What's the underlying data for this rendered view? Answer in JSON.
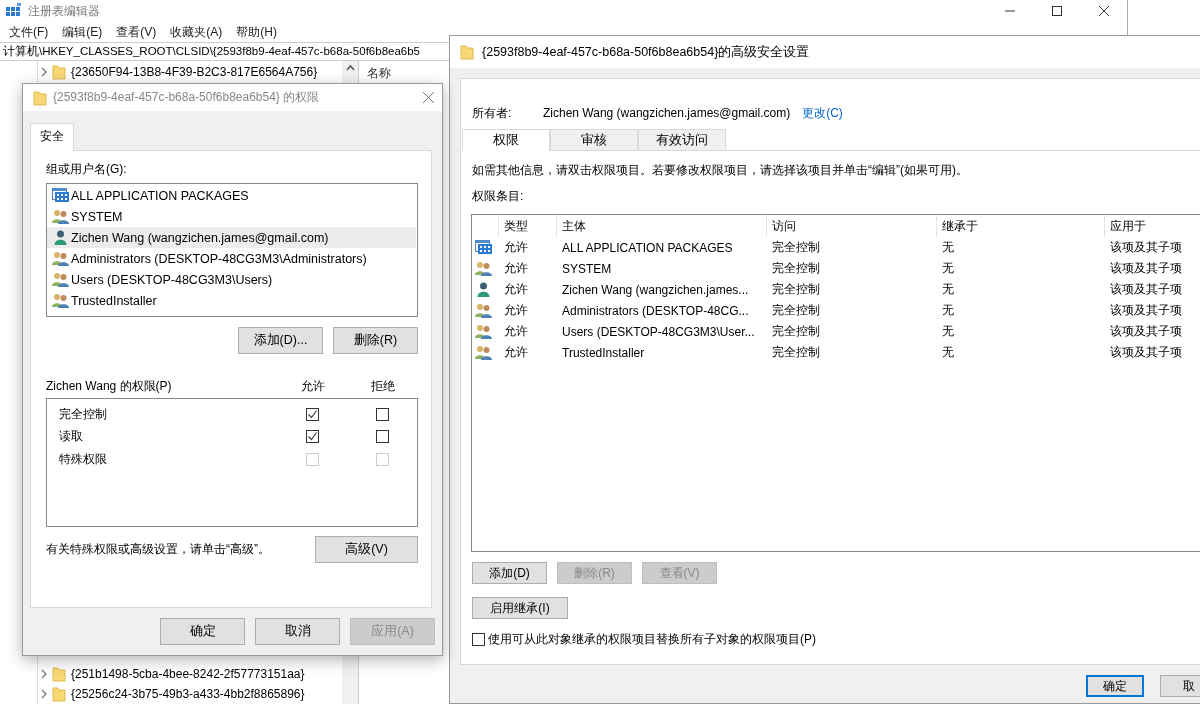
{
  "registry_editor": {
    "title": "注册表编辑器",
    "menu": [
      "文件(F)",
      "编辑(E)",
      "查看(V)",
      "收藏夹(A)",
      "帮助(H)"
    ],
    "address": "计算机\\HKEY_CLASSES_ROOT\\CLSID\\{2593f8b9-4eaf-457c-b68a-50f6b8ea6b5",
    "tree_top": [
      "{23650F94-13B8-4F39-B2C3-817E6564A756}"
    ],
    "tree_bottom": [
      "{251b1498-5cba-4bee-8242-2f57773151aa}",
      "{25256c24-3b75-49b3-a433-4bb2f8865896}"
    ],
    "list_header": "名称"
  },
  "permissions_dialog": {
    "title": "{2593f8b9-4eaf-457c-b68a-50f6b8ea6b54} 的权限",
    "tabs": [
      {
        "label": "安全",
        "selected": true
      }
    ],
    "group_label": "组或用户名(G):",
    "principals": [
      {
        "name": "ALL APPLICATION PACKAGES",
        "kind": "package",
        "selected": false
      },
      {
        "name": "SYSTEM",
        "kind": "group",
        "selected": false
      },
      {
        "name": "Zichen Wang (wangzichen.james@gmail.com)",
        "kind": "user",
        "selected": true
      },
      {
        "name": "Administrators (DESKTOP-48CG3M3\\Administrators)",
        "kind": "group",
        "selected": false
      },
      {
        "name": "Users (DESKTOP-48CG3M3\\Users)",
        "kind": "group",
        "selected": false
      },
      {
        "name": "TrustedInstaller",
        "kind": "group",
        "selected": false
      }
    ],
    "list_buttons": [
      "添加(D)...",
      "删除(R)"
    ],
    "perm_label": "Zichen Wang 的权限(P)",
    "allow_label": "允许",
    "deny_label": "拒绝",
    "permissions": [
      {
        "name": "完全控制",
        "allow": true,
        "deny": false,
        "disabled": false
      },
      {
        "name": "读取",
        "allow": true,
        "deny": false,
        "disabled": false
      },
      {
        "name": "特殊权限",
        "allow": false,
        "deny": false,
        "disabled": true
      }
    ],
    "advanced_hint": "有关特殊权限或高级设置，请单击“高级”。",
    "advanced_button": "高级(V)",
    "buttons": [
      {
        "label": "确定",
        "disabled": false
      },
      {
        "label": "取消",
        "disabled": false
      },
      {
        "label": "应用(A)",
        "disabled": true
      }
    ]
  },
  "advanced_dialog": {
    "title": "{2593f8b9-4eaf-457c-b68a-50f6b8ea6b54}的高级安全设置",
    "owner_label": "所有者:",
    "owner": "Zichen Wang (wangzichen.james@gmail.com)",
    "change_link": "更改(C)",
    "tabs": [
      {
        "label": "权限",
        "selected": true
      },
      {
        "label": "审核",
        "selected": false
      },
      {
        "label": "有效访问",
        "selected": false
      }
    ],
    "info": "如需其他信息，请双击权限项目。若要修改权限项目，请选择该项目并单击“编辑”(如果可用)。",
    "entries_label": "权限条目:",
    "table": {
      "columns": [
        "类型",
        "主体",
        "访问",
        "继承于",
        "应用于"
      ],
      "rows": [
        {
          "kind": "package",
          "type": "允许",
          "principal": "ALL APPLICATION PACKAGES",
          "access": "完全控制",
          "inherited_from": "无",
          "applies_to": "该项及其子项"
        },
        {
          "kind": "group",
          "type": "允许",
          "principal": "SYSTEM",
          "access": "完全控制",
          "inherited_from": "无",
          "applies_to": "该项及其子项"
        },
        {
          "kind": "user",
          "type": "允许",
          "principal": "Zichen Wang (wangzichen.james...",
          "access": "完全控制",
          "inherited_from": "无",
          "applies_to": "该项及其子项"
        },
        {
          "kind": "group",
          "type": "允许",
          "principal": "Administrators (DESKTOP-48CG...",
          "access": "完全控制",
          "inherited_from": "无",
          "applies_to": "该项及其子项"
        },
        {
          "kind": "group",
          "type": "允许",
          "principal": "Users (DESKTOP-48CG3M3\\User...",
          "access": "完全控制",
          "inherited_from": "无",
          "applies_to": "该项及其子项"
        },
        {
          "kind": "group",
          "type": "允许",
          "principal": "TrustedInstaller",
          "access": "完全控制",
          "inherited_from": "无",
          "applies_to": "该项及其子项"
        }
      ]
    },
    "action_buttons": [
      {
        "label": "添加(D)",
        "disabled": false
      },
      {
        "label": "删除(R)",
        "disabled": true
      },
      {
        "label": "查看(V)",
        "disabled": true
      }
    ],
    "inherit_button": "启用继承(I)",
    "replace_checkbox": {
      "label": "使用可从此对象继承的权限项目替换所有子对象的权限项目(P)",
      "checked": false
    },
    "footer_buttons": [
      {
        "label": "确定",
        "focused": true
      },
      {
        "label": "取",
        "focused": false
      }
    ]
  }
}
